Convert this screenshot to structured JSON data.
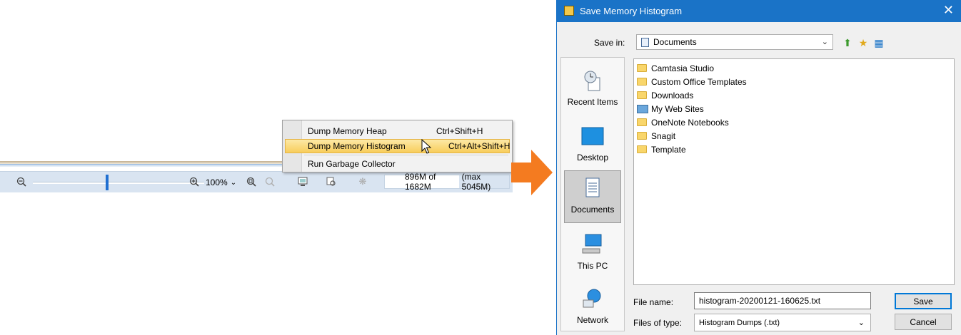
{
  "statusbar": {
    "zoom_value": "100%",
    "memory_used": "896M of 1682M",
    "memory_max": "(max 5045M)"
  },
  "context_menu": {
    "items": [
      {
        "label": "Dump Memory Heap",
        "shortcut": "Ctrl+Shift+H"
      },
      {
        "label": "Dump Memory Histogram",
        "shortcut": "Ctrl+Alt+Shift+H"
      },
      {
        "label": "Run Garbage Collector",
        "shortcut": ""
      }
    ]
  },
  "dialog": {
    "title": "Save Memory Histogram",
    "save_in_label": "Save in:",
    "save_in_value": "Documents",
    "places": [
      "Recent Items",
      "Desktop",
      "Documents",
      "This PC",
      "Network"
    ],
    "files": [
      "Camtasia Studio",
      "Custom Office Templates",
      "Downloads",
      "My Web Sites",
      "OneNote Notebooks",
      "Snagit",
      "Template"
    ],
    "file_name_label": "File name:",
    "file_name_value": "histogram-20200121-160625.txt",
    "file_type_label": "Files of type:",
    "file_type_value": "Histogram Dumps (.txt)",
    "save_button": "Save",
    "cancel_button": "Cancel"
  },
  "colors": {
    "accent": "#1a73c7",
    "arrow": "#f47b20",
    "highlight": "#f8cd5b"
  }
}
